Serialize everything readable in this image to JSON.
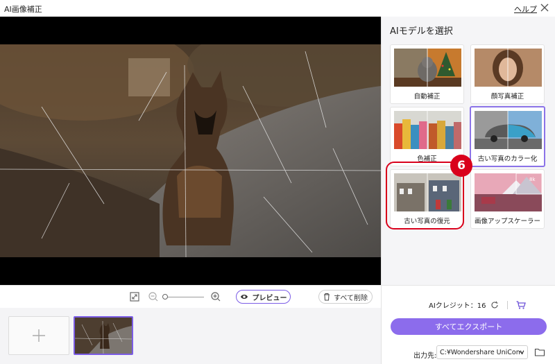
{
  "window": {
    "title": "AI画像補正",
    "help": "ヘルプ"
  },
  "panel": {
    "title": "AIモデルを選択",
    "models": [
      {
        "label": "自動補正"
      },
      {
        "label": "顔写真補正"
      },
      {
        "label": "色補正"
      },
      {
        "label": "古い写真のカラー化"
      },
      {
        "label": "古い写真の復元"
      },
      {
        "label": "画像アップスケーラー"
      }
    ],
    "upscale_badge": "8k",
    "step_badge": "6"
  },
  "toolbar": {
    "preview_label": "プレビュー",
    "delete_label": "すべて削除"
  },
  "footer": {
    "credits_label": "AIクレジット：16",
    "export_label": "すべてエクスポート",
    "output_label": "出力先:",
    "output_path": "C:¥Wondershare UniConv"
  },
  "colors": {
    "accent": "#8c6cec",
    "highlight": "#d9001b"
  },
  "icons": [
    "close-icon",
    "fit-screen-icon",
    "zoom-out-icon",
    "zoom-in-icon",
    "eye-icon",
    "trash-icon",
    "plus-icon",
    "refresh-icon",
    "cart-icon",
    "chevron-down-icon",
    "folder-icon"
  ]
}
